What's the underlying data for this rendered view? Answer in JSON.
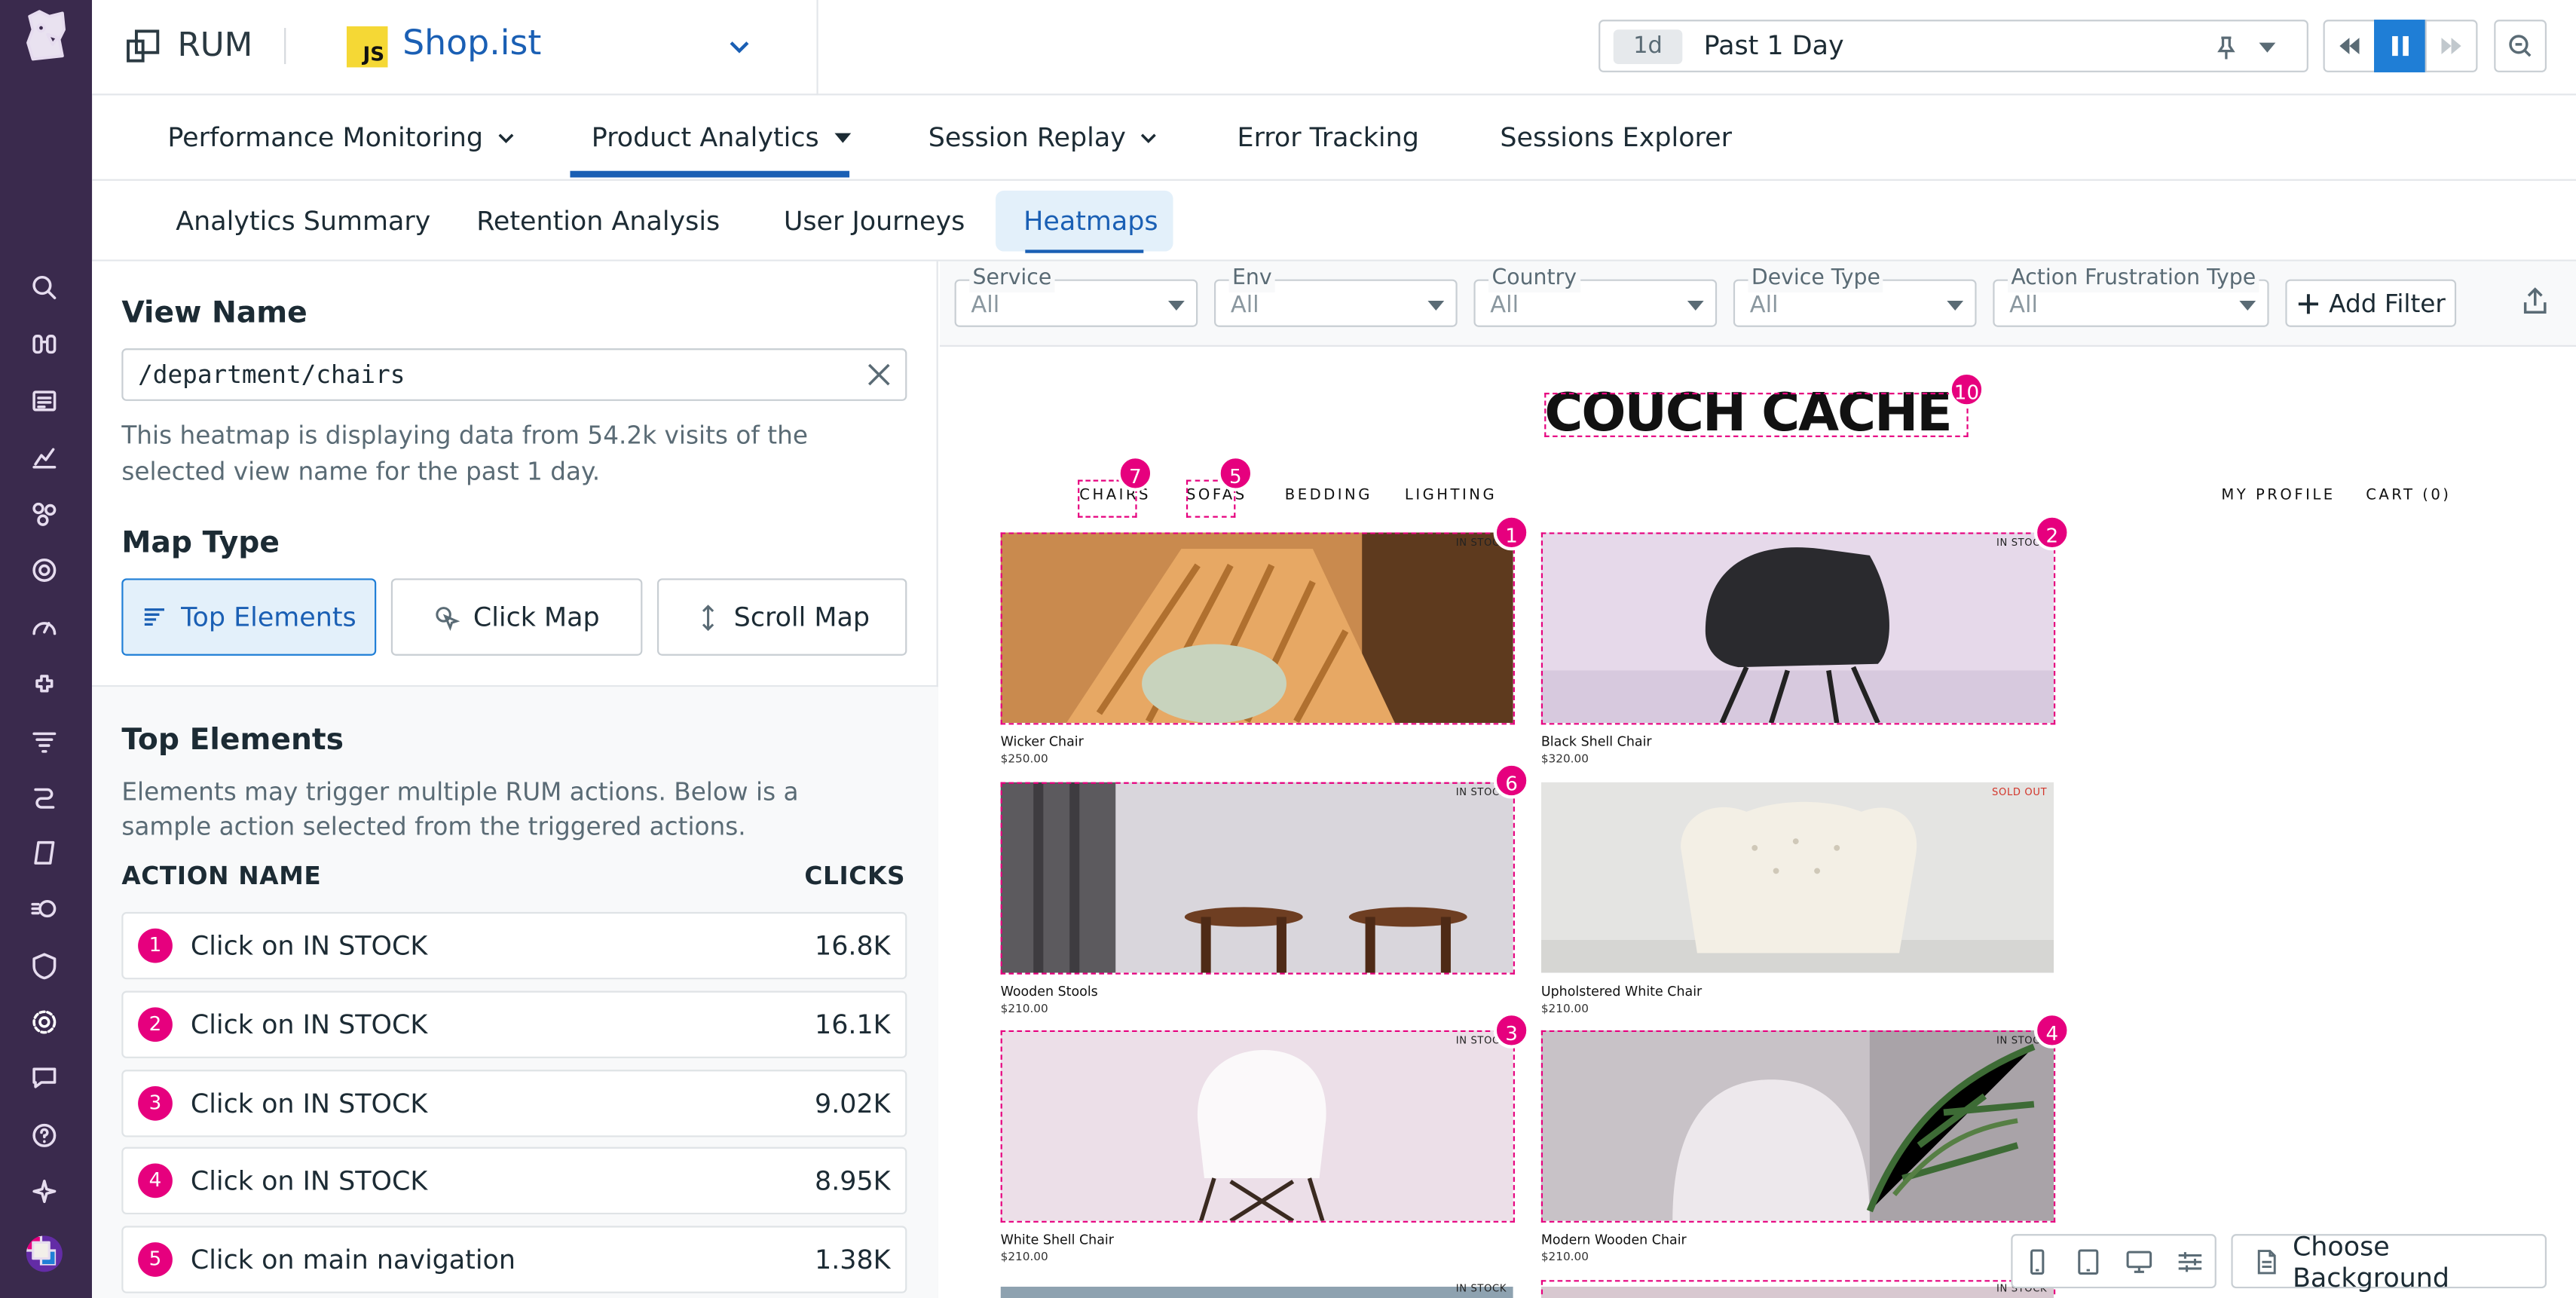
{
  "header": {
    "product": "RUM",
    "app_badge": "JS",
    "app_name": "Shop.ist"
  },
  "time": {
    "badge": "1d",
    "label": "Past 1 Day"
  },
  "primary_tabs": [
    "Performance Monitoring",
    "Product Analytics",
    "Session Replay",
    "Error Tracking",
    "Sessions Explorer"
  ],
  "secondary_tabs": [
    "Analytics Summary",
    "Retention Analysis",
    "User Journeys",
    "Heatmaps"
  ],
  "left": {
    "view_name_title": "View Name",
    "view_name_value": "/department/chairs",
    "view_desc": "This heatmap is displaying data from 54.2k visits of the selected view name for the past 1 day.",
    "map_type_title": "Map Type",
    "map_types": [
      "Top Elements",
      "Click Map",
      "Scroll Map"
    ],
    "top_elements_title": "Top Elements",
    "top_elements_desc": "Elements may trigger multiple RUM actions. Below is a sample action selected from the triggered actions.",
    "col_action": "ACTION NAME",
    "col_clicks": "CLICKS",
    "rows": [
      {
        "n": "1",
        "label": "Click on IN STOCK",
        "clicks": "16.8K"
      },
      {
        "n": "2",
        "label": "Click on IN STOCK",
        "clicks": "16.1K"
      },
      {
        "n": "3",
        "label": "Click on IN STOCK",
        "clicks": "9.02K"
      },
      {
        "n": "4",
        "label": "Click on IN STOCK",
        "clicks": "8.95K"
      },
      {
        "n": "5",
        "label": "Click on main navigation",
        "clicks": "1.38K"
      }
    ]
  },
  "filters": [
    {
      "label": "Service",
      "value": "All"
    },
    {
      "label": "Env",
      "value": "All"
    },
    {
      "label": "Country",
      "value": "All"
    },
    {
      "label": "Device Type",
      "value": "All"
    },
    {
      "label": "Action Frustration Type",
      "value": "All"
    }
  ],
  "add_filter": "Add Filter",
  "shop": {
    "brand": "COUCH CACHE",
    "nav": [
      "CHAIRS",
      "SOFAS",
      "BEDDING",
      "LIGHTING"
    ],
    "account": [
      "MY PROFILE",
      "CART (0)"
    ],
    "in_stock": "IN STOCK",
    "sold_out": "SOLD OUT",
    "products": [
      {
        "name": "Wicker Chair",
        "price": "$250.00"
      },
      {
        "name": "Black Shell Chair",
        "price": "$320.00"
      },
      {
        "name": "Wooden Stools",
        "price": "$210.00"
      },
      {
        "name": "Upholstered White Chair",
        "price": "$210.00"
      },
      {
        "name": "White Shell Chair",
        "price": "$210.00"
      },
      {
        "name": "Modern Wooden Chair",
        "price": "$210.00"
      }
    ],
    "pins": [
      "1",
      "2",
      "3",
      "4",
      "5",
      "6",
      "7",
      "10"
    ]
  },
  "choose_background": "Choose Background",
  "colors": {
    "nav": "#3a2a4d",
    "accent": "#1a5fb4",
    "heat": "#e6007e"
  }
}
